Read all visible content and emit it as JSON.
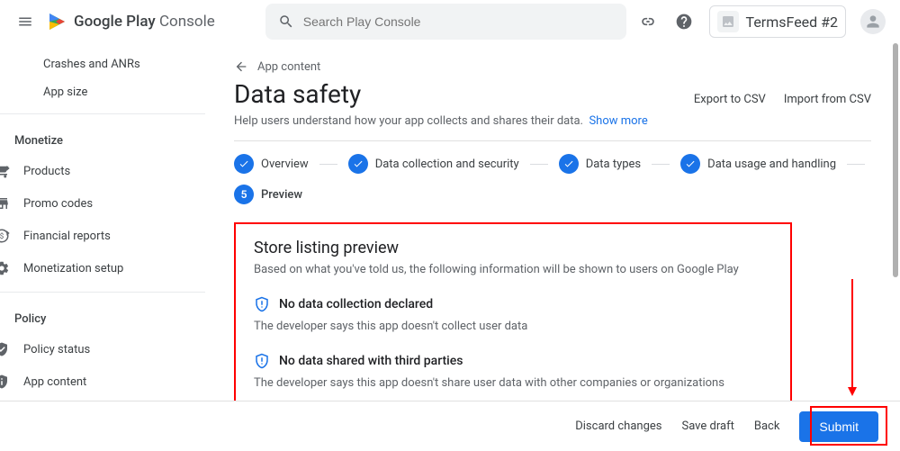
{
  "topbar": {
    "logo_play": "Google Play",
    "logo_console": "Console",
    "search_placeholder": "Search Play Console",
    "account_name": "TermsFeed #2"
  },
  "sidebar": {
    "quality": {
      "crashes": "Crashes and ANRs",
      "appsize": "App size"
    },
    "monetize_header": "Monetize",
    "monetize": {
      "products": "Products",
      "promo": "Promo codes",
      "financial": "Financial reports",
      "monetization": "Monetization setup"
    },
    "policy_header": "Policy",
    "policy": {
      "status": "Policy status",
      "appcontent": "App content"
    }
  },
  "main": {
    "crumb": "App content",
    "title": "Data safety",
    "subtitle_text": "Help users understand how your app collects and shares their data.",
    "subtitle_link": "Show more",
    "actions": {
      "export": "Export to CSV",
      "import": "Import from CSV"
    },
    "stepper": {
      "s1": "Overview",
      "s2": "Data collection and security",
      "s3": "Data types",
      "s4": "Data usage and handling",
      "s5_num": "5",
      "s5": "Preview"
    },
    "preview": {
      "title": "Store listing preview",
      "subtitle": "Based on what you've told us, the following information will be shown to users on Google Play",
      "row1_head": "No data collection declared",
      "row1_text": "The developer says this app doesn't collect user data",
      "row2_head": "No data shared with third parties",
      "row2_text": "The developer says this app doesn't share user data with other companies or organizations"
    }
  },
  "bottombar": {
    "discard": "Discard changes",
    "savedraft": "Save draft",
    "back": "Back",
    "submit": "Submit"
  }
}
